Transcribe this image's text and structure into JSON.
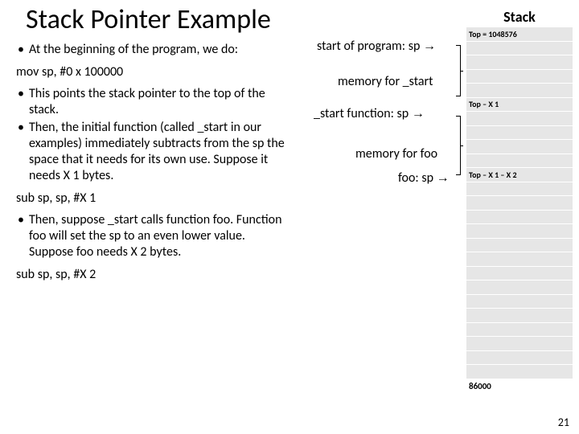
{
  "title": "Stack Pointer Example",
  "bullets": {
    "b1": "At the beginning of the program, we do:",
    "b2": "This points the stack pointer to the top of the stack.",
    "b3": "Then, the initial function (called _start in our examples) immediately subtracts from the sp the space that it needs for its own use. Suppose it needs X 1 bytes.",
    "b4": "Then, suppose _start calls function foo. Function foo will set the sp to an even lower value. Suppose foo needs X 2 bytes."
  },
  "code": {
    "c1": "mov sp, #0 x 100000",
    "c2": "sub sp, sp, #X 1",
    "c3": "sub sp, sp, #X 2"
  },
  "annot": {
    "a1_pre": "start of program: sp ",
    "a2": "memory for _start",
    "a3_pre": "_start function:  sp ",
    "a4": "memory for foo",
    "a5_pre": "foo:  sp ",
    "arrow": "→"
  },
  "stack": {
    "header": "Stack",
    "labels": {
      "l1": "Top = 1048576",
      "l2": "Top – X 1",
      "l3": "Top – X 1 – X 2"
    },
    "bottom": "86000"
  },
  "page": "21"
}
